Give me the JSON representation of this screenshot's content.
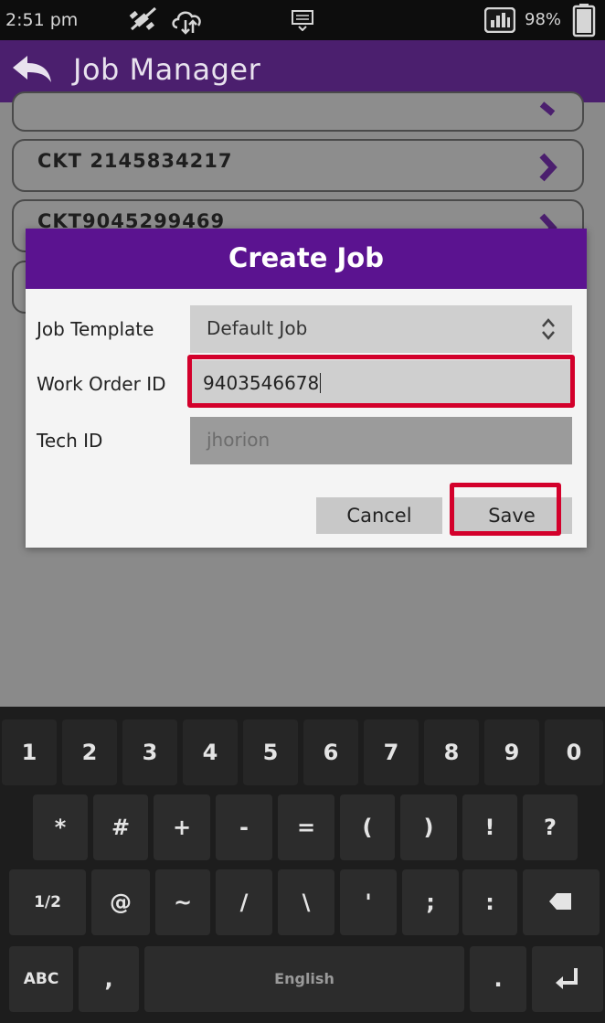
{
  "status_bar": {
    "time": "2:51 pm",
    "battery_percent": "98%",
    "icons": [
      "satellite-off-icon",
      "cloud-sync-icon",
      "keyboard-indicator-icon",
      "signal-app-icon",
      "battery-icon"
    ]
  },
  "app_bar": {
    "title": "Job Manager",
    "back_icon": "back-arrow-icon"
  },
  "job_list": {
    "items": [
      {
        "label": "CKT 2145834217"
      },
      {
        "label": "CKT9045299469"
      }
    ]
  },
  "dialog": {
    "title": "Create Job",
    "fields": [
      {
        "label": "Job Template",
        "value": "Default Job",
        "type": "select"
      },
      {
        "label": "Work Order ID",
        "value": "9403546678",
        "type": "text"
      },
      {
        "label": "Tech ID",
        "value": "jhorion",
        "type": "text",
        "disabled": true
      }
    ],
    "cancel_label": "Cancel",
    "save_label": "Save"
  },
  "keyboard": {
    "row1": [
      "1",
      "2",
      "3",
      "4",
      "5",
      "6",
      "7",
      "8",
      "9",
      "0"
    ],
    "row2": [
      "*",
      "#",
      "+",
      "-",
      "=",
      "(",
      ")",
      "!",
      "?"
    ],
    "row3": [
      "1/2",
      "@",
      "~",
      "/",
      "\\",
      "'",
      ";",
      ":"
    ],
    "row4": {
      "mode": "ABC",
      "comma": ",",
      "space": "English",
      "period": "."
    }
  },
  "colors": {
    "app_bar": "#4b1f6e",
    "dialog_header": "#5b1390",
    "highlight": "#d3002b",
    "keyboard_bg": "#1d1d1d"
  }
}
